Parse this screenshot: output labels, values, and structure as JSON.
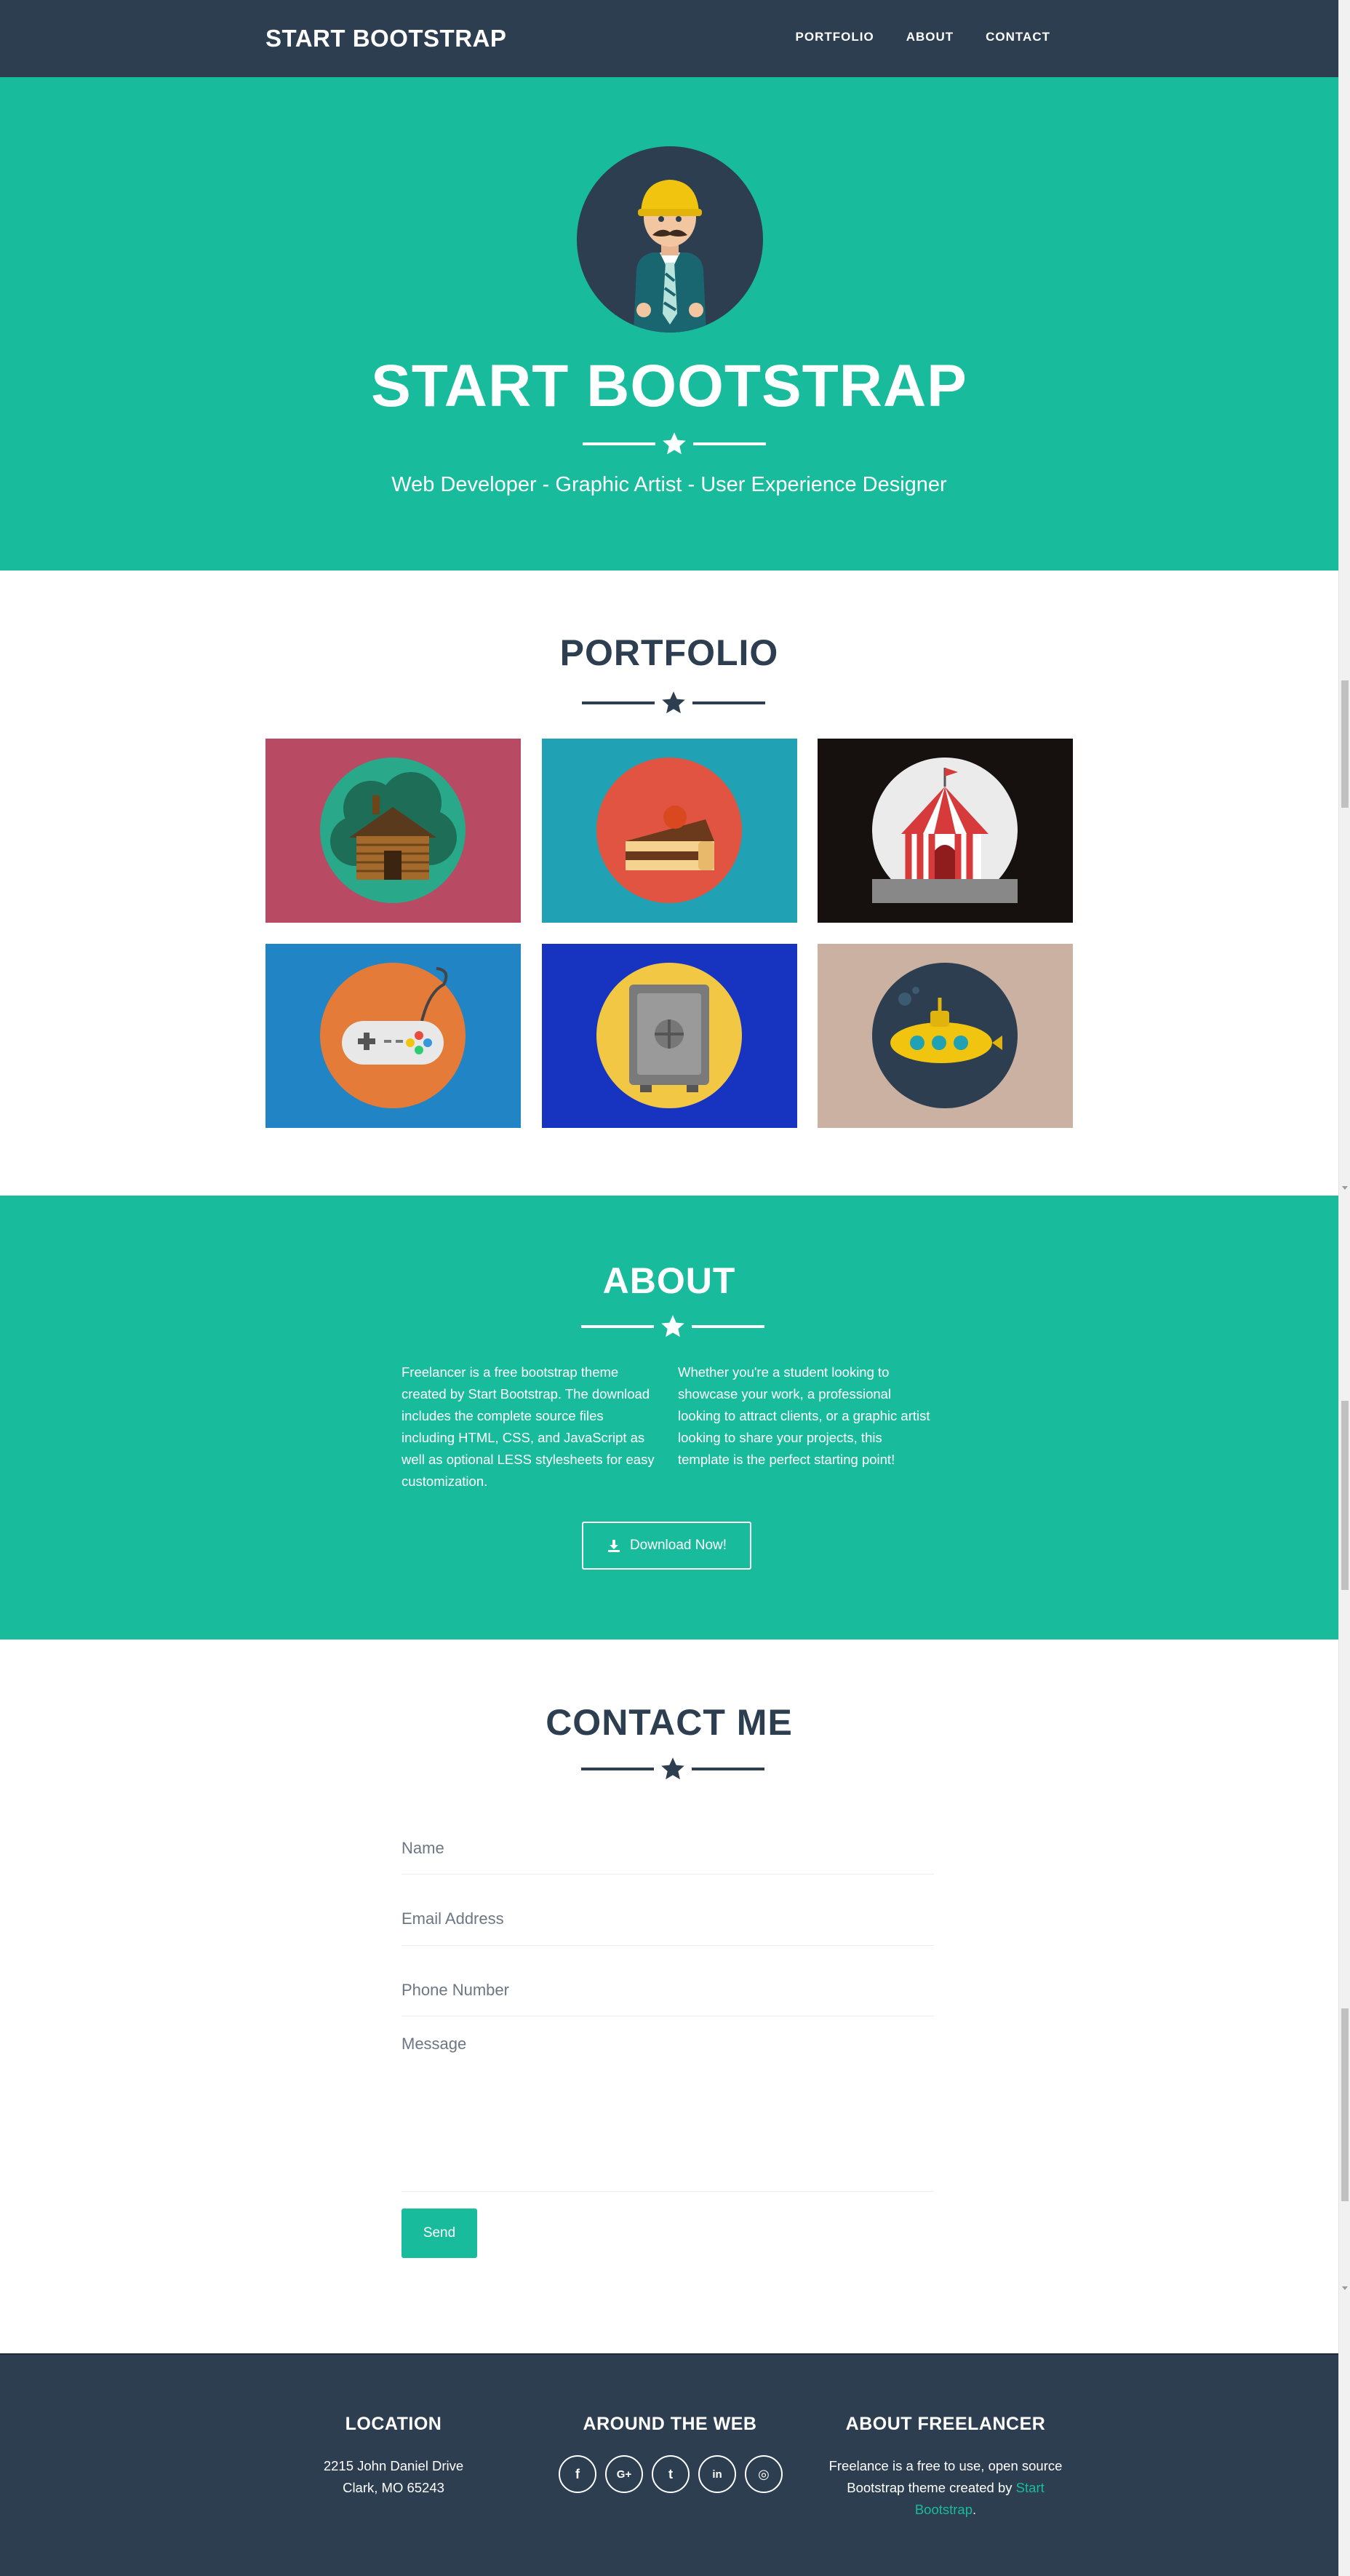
{
  "nav": {
    "brand": "START BOOTSTRAP",
    "links": [
      "PORTFOLIO",
      "ABOUT",
      "CONTACT"
    ]
  },
  "header": {
    "title": "START BOOTSTRAP",
    "subtitle": "Web Developer - Graphic Artist - User Experience Designer",
    "avatar_icon": "developer-avatar-icon"
  },
  "portfolio": {
    "title": "PORTFOLIO",
    "tiles": [
      {
        "icon": "cabin-icon",
        "bg": "#b94a63"
      },
      {
        "icon": "cake-icon",
        "bg": "#20a1b4"
      },
      {
        "icon": "circus-tent-icon",
        "bg": "#16110f"
      },
      {
        "icon": "game-controller-icon",
        "bg": "#2084c5"
      },
      {
        "icon": "safe-icon",
        "bg": "#1634c0"
      },
      {
        "icon": "submarine-icon",
        "bg": "#cbb1a1"
      }
    ]
  },
  "about": {
    "title": "ABOUT",
    "left_text": "Freelancer is a free bootstrap theme created by Start Bootstrap. The download includes the complete source files including HTML, CSS, and JavaScript as well as optional LESS stylesheets for easy customization.",
    "right_text": "Whether you're a student looking to showcase your work, a professional looking to attract clients, or a graphic artist looking to share your projects, this template is the perfect starting point!",
    "button": "Download Now!",
    "button_icon": "download-icon"
  },
  "contact": {
    "title": "CONTACT ME",
    "name_placeholder": "Name",
    "email_placeholder": "Email Address",
    "phone_placeholder": "Phone Number",
    "message_placeholder": "Message",
    "send": "Send"
  },
  "footer": {
    "location_title": "LOCATION",
    "address_line1": "2215 John Daniel Drive",
    "address_line2": "Clark, MO 65243",
    "web_title": "AROUND THE WEB",
    "social": [
      "f",
      "G+",
      "t",
      "in",
      "◎"
    ],
    "social_icons": [
      "facebook-icon",
      "google-plus-icon",
      "twitter-icon",
      "linkedin-icon",
      "dribbble-icon"
    ],
    "about_title": "ABOUT FREELANCER",
    "about_text": "Freelance is a free to use, open source Bootstrap theme created by",
    "about_link": "Start Bootstrap",
    "about_end": "."
  },
  "colors": {
    "primary": "#2c3e50",
    "accent": "#18bc9c"
  }
}
